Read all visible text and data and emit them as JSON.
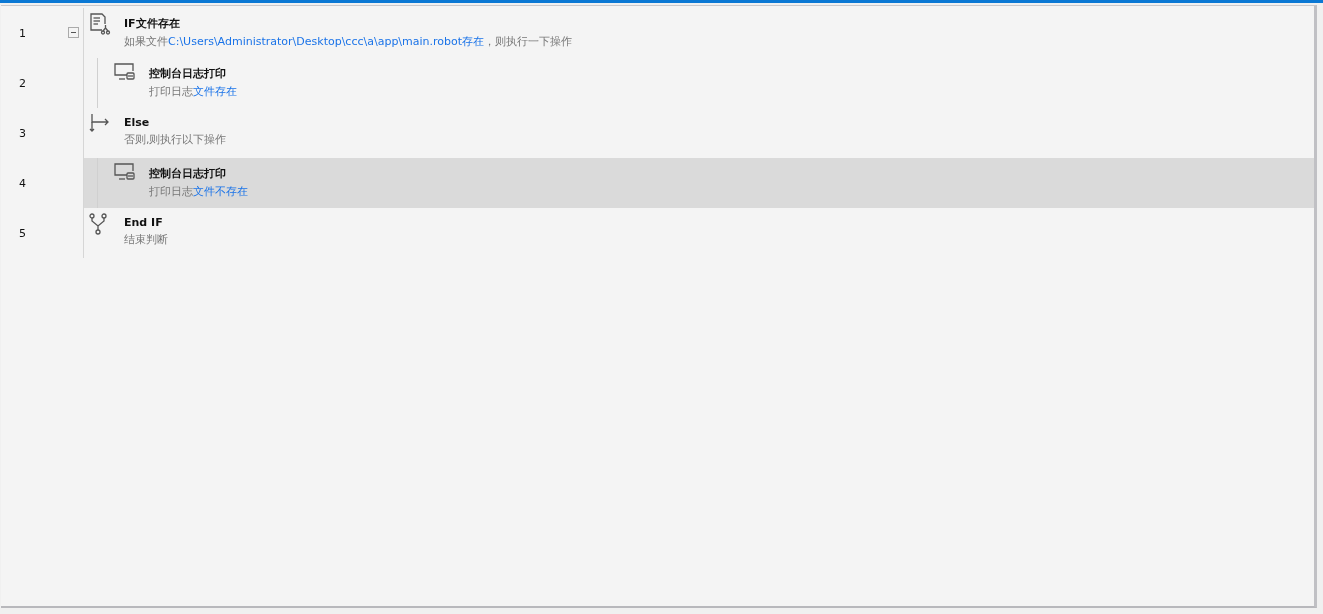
{
  "steps": [
    {
      "line": "1",
      "kind": "if",
      "title": "IF文件存在",
      "selected": false,
      "expanded": true,
      "description": [
        {
          "text": "如果文件",
          "highlight": false
        },
        {
          "text": "C:\\Users\\Administrator\\Desktop\\ccc\\a\\app\\main.robot存在",
          "highlight": true
        },
        {
          "text": "，则执行一下操作",
          "highlight": false
        }
      ],
      "children": [
        {
          "line": "2",
          "kind": "log",
          "title": "控制台日志打印",
          "selected": false,
          "description": [
            {
              "text": "打印日志",
              "highlight": false
            },
            {
              "text": "文件存在",
              "highlight": true
            }
          ]
        }
      ]
    },
    {
      "line": "3",
      "kind": "else",
      "title": "Else",
      "selected": false,
      "description": [
        {
          "text": "否则,则执行以下操作",
          "highlight": false
        }
      ],
      "children": [
        {
          "line": "4",
          "kind": "log",
          "title": "控制台日志打印",
          "selected": true,
          "description": [
            {
              "text": "打印日志",
              "highlight": false
            },
            {
              "text": "文件不存在",
              "highlight": true
            }
          ]
        }
      ]
    },
    {
      "line": "5",
      "kind": "endif",
      "title": "End IF",
      "selected": false,
      "description": [
        {
          "text": "结束判断",
          "highlight": false
        }
      ]
    }
  ]
}
